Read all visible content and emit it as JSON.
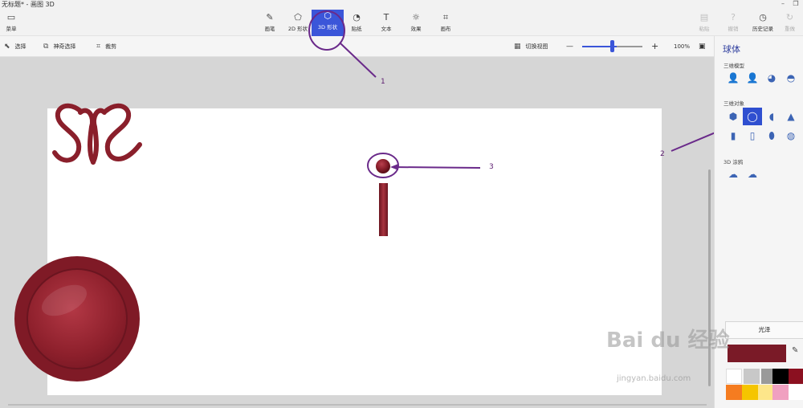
{
  "window": {
    "title": "无标题* - 画图 3D"
  },
  "ribbon": {
    "menu_label": "菜单",
    "tools": [
      {
        "label": "画笔",
        "icon": "brush-icon"
      },
      {
        "label": "2D 形状",
        "icon": "2d-shapes-icon"
      },
      {
        "label": "3D 形状",
        "icon": "3d-shapes-icon"
      },
      {
        "label": "贴纸",
        "icon": "stickers-icon"
      },
      {
        "label": "文本",
        "icon": "text-icon"
      },
      {
        "label": "效果",
        "icon": "effects-icon"
      },
      {
        "label": "画布",
        "icon": "canvas-icon"
      }
    ],
    "right_tools": [
      {
        "label": "粘贴",
        "icon": "paste-icon"
      },
      {
        "label": "撤销",
        "icon": "undo-icon"
      },
      {
        "label": "历史记录",
        "icon": "history-icon"
      },
      {
        "label": "重做",
        "icon": "redo-icon"
      }
    ]
  },
  "toolbar": {
    "select_label": "选择",
    "magic_select_label": "神奇选择",
    "crop_label": "裁剪",
    "switch_view_label": "切换视图",
    "zoom_value": "100%",
    "zoom_minus": "—",
    "zoom_plus": "+"
  },
  "panel": {
    "title": "球体",
    "section_models": "三维模型",
    "section_objects": "三维对象",
    "section_doodle": "3D 涂鸦",
    "gloss_label": "光泽",
    "selected_color": "#7a1a27"
  },
  "palette": {
    "row1": [
      "#ffffff",
      "#c8c8c8",
      "#000000",
      "#8b1020"
    ],
    "row2": [
      "#f57c20",
      "#f5c500",
      "#fde68a",
      "#f0a0c0",
      "#ffffff"
    ]
  },
  "annotations": {
    "a1": "1",
    "a2": "2",
    "a3": "3"
  },
  "watermark": {
    "main": "Bai du 经验",
    "sub": "jingyan.baidu.com"
  }
}
